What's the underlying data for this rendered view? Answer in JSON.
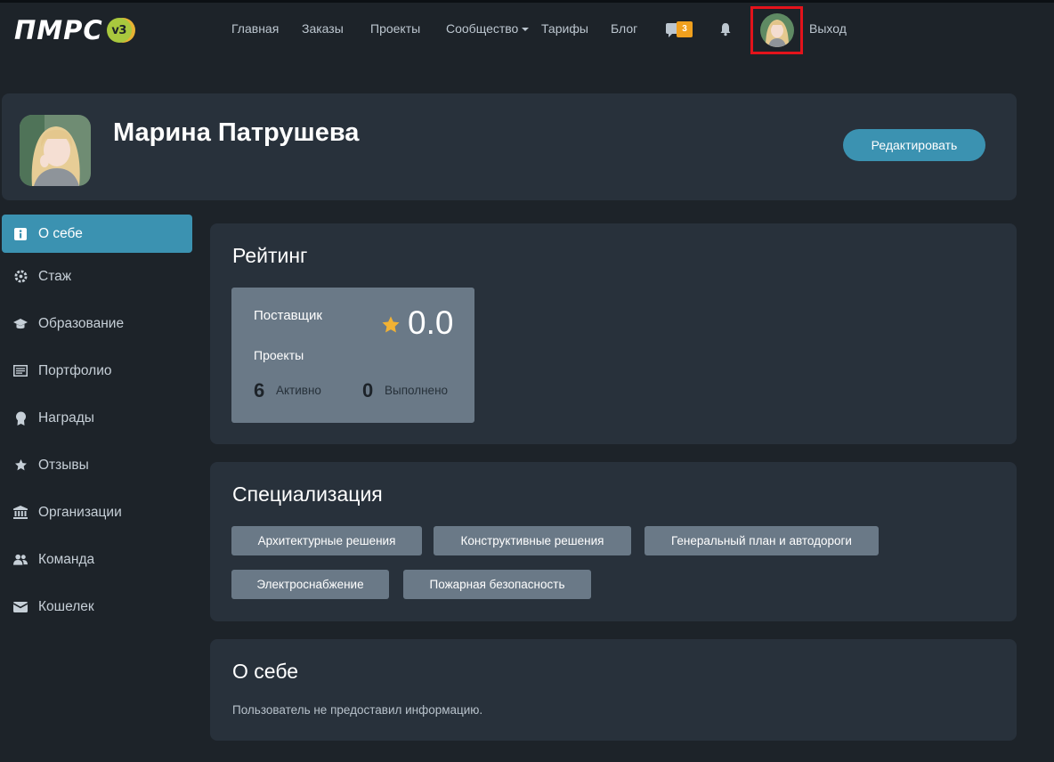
{
  "brand": {
    "logo_text": "ПМРС",
    "version_badge": "v3"
  },
  "nav": {
    "items": [
      {
        "label": "Главная"
      },
      {
        "label": "Заказы"
      },
      {
        "label": "Проекты"
      },
      {
        "label": "Сообщество"
      },
      {
        "label": "Тарифы"
      },
      {
        "label": "Блог"
      }
    ],
    "messages_count": "3",
    "logout_label": "Выход"
  },
  "profile": {
    "name": "Марина Патрушева",
    "edit_label": "Редактировать"
  },
  "sidebar": {
    "items": [
      {
        "label": "О себе",
        "icon": "info-icon",
        "active": true
      },
      {
        "label": "Стаж",
        "icon": "gear-icon"
      },
      {
        "label": "Образование",
        "icon": "graduation-cap-icon"
      },
      {
        "label": "Портфолио",
        "icon": "list-alt-icon"
      },
      {
        "label": "Награды",
        "icon": "award-icon"
      },
      {
        "label": "Отзывы",
        "icon": "star-icon"
      },
      {
        "label": "Организации",
        "icon": "institution-icon"
      },
      {
        "label": "Команда",
        "icon": "users-icon"
      },
      {
        "label": "Кошелек",
        "icon": "wallet-icon"
      }
    ]
  },
  "rating": {
    "title": "Рейтинг",
    "role": "Поставщик",
    "score": "0.0",
    "projects_label": "Проекты",
    "active_count": "6",
    "active_label": "Активно",
    "done_count": "0",
    "done_label": "Выполнено"
  },
  "specialization": {
    "title": "Специализация",
    "chips": [
      "Архитектурные решения",
      "Конструктивные решения",
      "Генеральный план и автодороги",
      "Электроснабжение",
      "Пожарная безопасность"
    ]
  },
  "about": {
    "title": "О себе",
    "text": "Пользователь не предоставил информацию."
  },
  "colors": {
    "background": "#1d2329",
    "card": "#28313b",
    "accent": "#3b92b1",
    "chip": "#6a7987",
    "badge": "#f0a01e",
    "highlight_border": "#e3131b"
  }
}
